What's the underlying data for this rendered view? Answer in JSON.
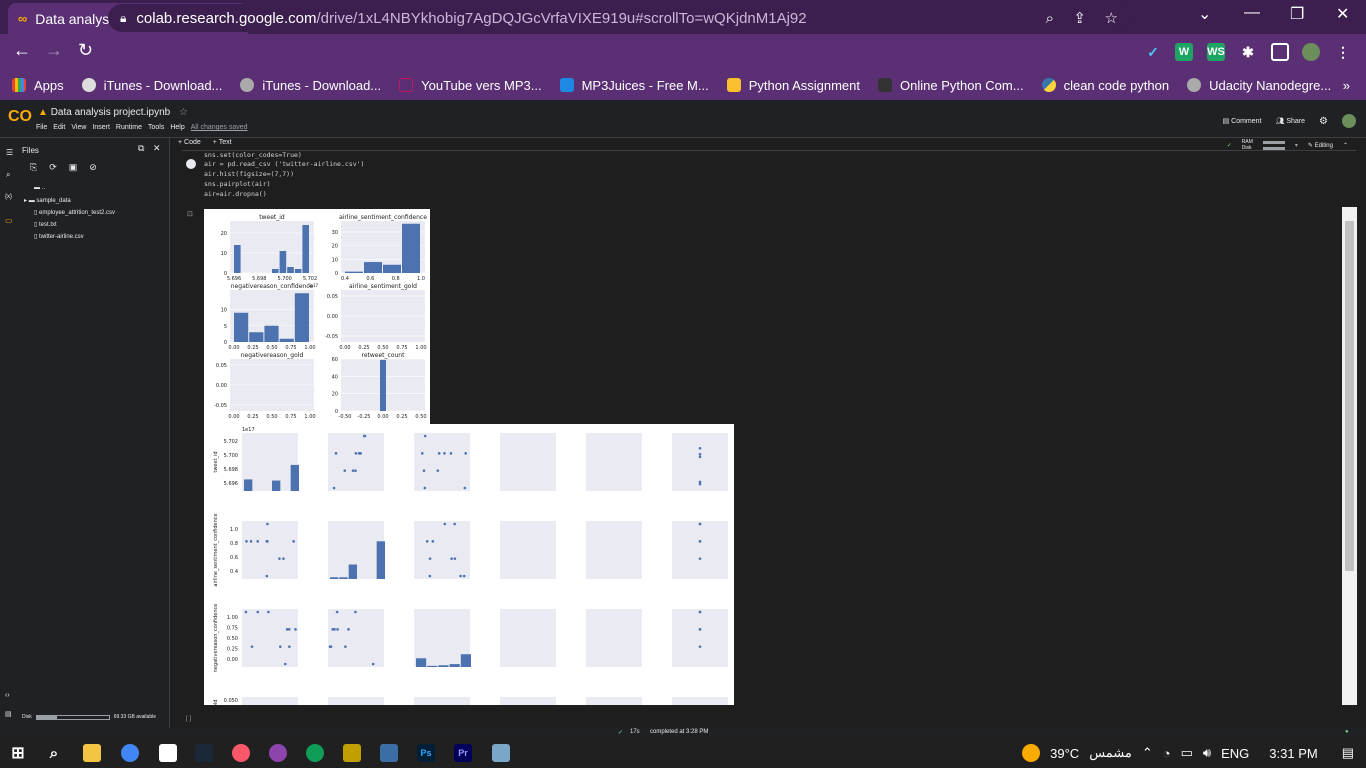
{
  "browser": {
    "tab_title": "Data analysis project.ipynb - Cola",
    "url_host": "colab.research.google.com",
    "url_path": "/drive/1xL4NBYkhobig7AgDQJGcVrfaVIXE919u#scrollTo=wQKjdnM1Aj92",
    "bookmarks": [
      "Apps",
      "iTunes - Download...",
      "iTunes - Download...",
      "YouTube vers MP3...",
      "MP3Juices - Free M...",
      "Python Assignment",
      "Online Python Com...",
      "clean code python",
      "Udacity Nanodegre..."
    ]
  },
  "colab": {
    "logo": "CO",
    "notebook_name": "Data analysis project.ipynb",
    "menu": [
      "File",
      "Edit",
      "View",
      "Insert",
      "Runtime",
      "Tools",
      "Help"
    ],
    "saved_status": "All changes saved",
    "comment": "Comment",
    "share": "Share",
    "add_code": "+ Code",
    "add_text": "+ Text",
    "ram": "RAM",
    "disk": "Disk",
    "editing": "Editing"
  },
  "sidebar": {
    "title": "Files",
    "items": [
      "..",
      "sample_data",
      "employee_attrition_test2.csv",
      "test.txt",
      "twitter-airline.csv"
    ],
    "disk_label": "Disk",
    "disk_avail": "69.33 GB available"
  },
  "code": {
    "lines": [
      "sns.set(color_codes=True)",
      "air = pd.read_csv ('twitter-airline.csv')",
      "air.hist(figsize=(7,7))",
      "sns.pairplot(air)",
      "air=air.dropna()"
    ]
  },
  "empty_cell": "[ ]",
  "status": {
    "check": "✓",
    "time": "17s",
    "text": "completed at 3:28 PM"
  },
  "hist_titles": [
    "tweet_id",
    "airline_sentiment_confidence",
    "negativereason_confidence",
    "airline_sentiment_gold",
    "negativereason_gold",
    "retweet_count"
  ],
  "pair": {
    "offset": "1e17",
    "row_labels": [
      "tweet_id",
      "airline_sentiment_confidence",
      "negativereason_confidence",
      "gold"
    ],
    "row0_ticks": [
      "5.702",
      "5.700",
      "5.698",
      "5.696"
    ],
    "row1_ticks": [
      "1.0",
      "0.8",
      "0.6",
      "0.4"
    ],
    "row2_ticks": [
      "1.00",
      "0.75",
      "0.50",
      "0.25",
      "0.00"
    ],
    "row3_ticks": [
      "0.050"
    ]
  },
  "chart_data": [
    {
      "type": "bar",
      "title": "tweet_id",
      "offset": "1e17",
      "categories": [
        "5.6955",
        "5.6965",
        "5.6975",
        "5.6985",
        "5.6995",
        "5.7005",
        "5.7010",
        "5.7015",
        "5.7020",
        "5.7025"
      ],
      "values": [
        14,
        0,
        0,
        0,
        0,
        2,
        11,
        3,
        2,
        24
      ],
      "ylim": [
        0,
        26
      ],
      "yticks": [
        "0",
        "10",
        "20"
      ],
      "xticks": [
        "5.696",
        "5.698",
        "5.700",
        "5.702"
      ]
    },
    {
      "type": "bar",
      "title": "airline_sentiment_confidence",
      "categories": [
        "0.35",
        "0.65",
        "0.70",
        "1.0"
      ],
      "values": [
        1,
        8,
        6,
        36
      ],
      "ylim": [
        0,
        38
      ],
      "yticks": [
        "0",
        "10",
        "20",
        "30"
      ],
      "xticks": [
        "0.4",
        "0.6",
        "0.8",
        "1.0"
      ]
    },
    {
      "type": "bar",
      "title": "negativereason_confidence",
      "categories": [
        "0.00",
        "0.33",
        "0.66",
        "0.70",
        "1.00"
      ],
      "values": [
        9,
        3,
        5,
        1,
        15
      ],
      "ylim": [
        0,
        16
      ],
      "yticks": [
        "0",
        "5",
        "10"
      ],
      "xticks": [
        "0.00",
        "0.25",
        "0.50",
        "0.75",
        "1.00"
      ]
    },
    {
      "type": "bar",
      "title": "airline_sentiment_gold",
      "categories": [],
      "values": [],
      "yticks": [
        "0.05",
        "0.00",
        "-0.05"
      ],
      "xticks": [
        "0.00",
        "0.25",
        "0.50",
        "0.75",
        "1.00"
      ]
    },
    {
      "type": "bar",
      "title": "negativereason_gold",
      "categories": [],
      "values": [],
      "yticks": [
        "0.05",
        "0.00",
        "-0.05"
      ],
      "xticks": [
        "0.00",
        "0.25",
        "0.50",
        "0.75",
        "1.00"
      ]
    },
    {
      "type": "bar",
      "title": "retweet_count",
      "categories": [
        "0.0"
      ],
      "values": [
        59
      ],
      "ylim": [
        0,
        60
      ],
      "yticks": [
        "0",
        "20",
        "40",
        "60"
      ],
      "xticks": [
        "-0.50",
        "-0.25",
        "0.00",
        "0.25",
        "0.50"
      ]
    }
  ],
  "taskbar": {
    "weather": "39°C",
    "weather_text": "مشمس",
    "lang": "ENG",
    "time": "3:31 PM"
  }
}
